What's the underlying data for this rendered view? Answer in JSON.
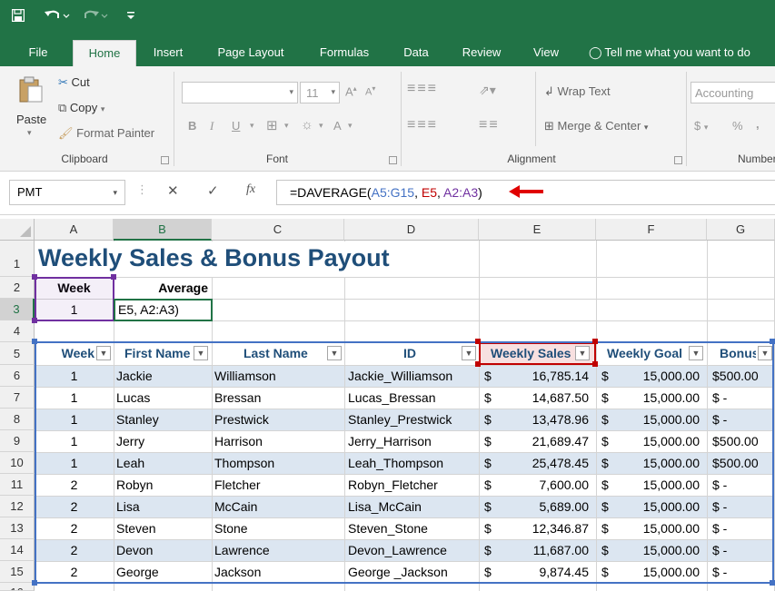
{
  "quick_access": {
    "save_icon": "save-icon",
    "undo_icon": "undo-icon",
    "redo_icon": "redo-icon",
    "customize_icon": "customize-icon"
  },
  "tabs": [
    "File",
    "Home",
    "Insert",
    "Page Layout",
    "Formulas",
    "Data",
    "Review",
    "View"
  ],
  "tell_me": "Tell me what you want to do",
  "clipboard": {
    "paste": "Paste",
    "cut": "Cut",
    "copy": "Copy",
    "format_painter": "Format Painter",
    "label": "Clipboard"
  },
  "font": {
    "size": "11",
    "bold": "B",
    "italic": "I",
    "underline": "U",
    "font_color": "A",
    "grow": "A",
    "shrink": "A",
    "label": "Font"
  },
  "alignment": {
    "wrap_text": "Wrap Text",
    "merge_center": "Merge & Center",
    "label": "Alignment"
  },
  "number": {
    "format": "Accounting",
    "currency": "$",
    "percent": "%",
    "comma": ",",
    "label": "Number"
  },
  "formula_bar": {
    "name_box": "PMT",
    "cancel": "✕",
    "enter": "✓",
    "fx": "fx",
    "formula_prefix": "=DAVERAGE(",
    "arg1": "A5:G15",
    "sep1": ", ",
    "arg2": "E5",
    "sep2": ", ",
    "arg3": "A2:A3",
    "formula_suffix": ")"
  },
  "columns": [
    "A",
    "B",
    "C",
    "D",
    "E",
    "F",
    "G"
  ],
  "rows": [
    "1",
    "2",
    "3",
    "4",
    "5",
    "6",
    "7",
    "8",
    "9",
    "10",
    "11",
    "12",
    "13",
    "14",
    "15",
    "16"
  ],
  "sheet": {
    "title": "Weekly Sales & Bonus Payout",
    "criteria_header_week": "Week",
    "criteria_header_average": "Average",
    "criteria_value": "1",
    "editing_text": "E5, A2:A3)",
    "table_headers": [
      "Week",
      "First Name",
      "Last Name",
      "ID",
      "Weekly Sales",
      "Weekly Goal",
      "Bonus"
    ],
    "table_rows": [
      {
        "week": "1",
        "first": "Jackie",
        "last": "Williamson",
        "id": "Jackie_Williamson",
        "sales": "16,785.14",
        "goal": "15,000.00",
        "bonus": "$500.00"
      },
      {
        "week": "1",
        "first": "Lucas",
        "last": "Bressan",
        "id": "Lucas_Bressan",
        "sales": "14,687.50",
        "goal": "15,000.00",
        "bonus": "$ -"
      },
      {
        "week": "1",
        "first": "Stanley",
        "last": "Prestwick",
        "id": "Stanley_Prestwick",
        "sales": "13,478.96",
        "goal": "15,000.00",
        "bonus": "$ -"
      },
      {
        "week": "1",
        "first": "Jerry",
        "last": "Harrison",
        "id": "Jerry_Harrison",
        "sales": "21,689.47",
        "goal": "15,000.00",
        "bonus": "$500.00"
      },
      {
        "week": "1",
        "first": "Leah",
        "last": "Thompson",
        "id": "Leah_Thompson",
        "sales": "25,478.45",
        "goal": "15,000.00",
        "bonus": "$500.00"
      },
      {
        "week": "2",
        "first": "Robyn",
        "last": "Fletcher",
        "id": "Robyn_Fletcher",
        "sales": "7,600.00",
        "goal": "15,000.00",
        "bonus": "$ -"
      },
      {
        "week": "2",
        "first": "Lisa",
        "last": "McCain",
        "id": "Lisa_McCain",
        "sales": "5,689.00",
        "goal": "15,000.00",
        "bonus": "$ -"
      },
      {
        "week": "2",
        "first": "Steven",
        "last": "Stone",
        "id": "Steven_Stone",
        "sales": "12,346.87",
        "goal": "15,000.00",
        "bonus": "$ -"
      },
      {
        "week": "2",
        "first": "Devon",
        "last": "Lawrence",
        "id": "Devon_Lawrence",
        "sales": "11,687.00",
        "goal": "15,000.00",
        "bonus": "$ -"
      },
      {
        "week": "2",
        "first": "George",
        "last": "Jackson",
        "id": "George _Jackson",
        "sales": "9,874.45",
        "goal": "15,000.00",
        "bonus": "$ -"
      }
    ],
    "currency_symbol": "$"
  },
  "colors": {
    "excel_green": "#217346",
    "title_blue": "#1f4e79",
    "band_blue": "#dce6f1",
    "range_blue": "#4472c4",
    "range_red": "#c00000",
    "range_purple": "#7030a0",
    "arrow_red": "#e00000"
  }
}
